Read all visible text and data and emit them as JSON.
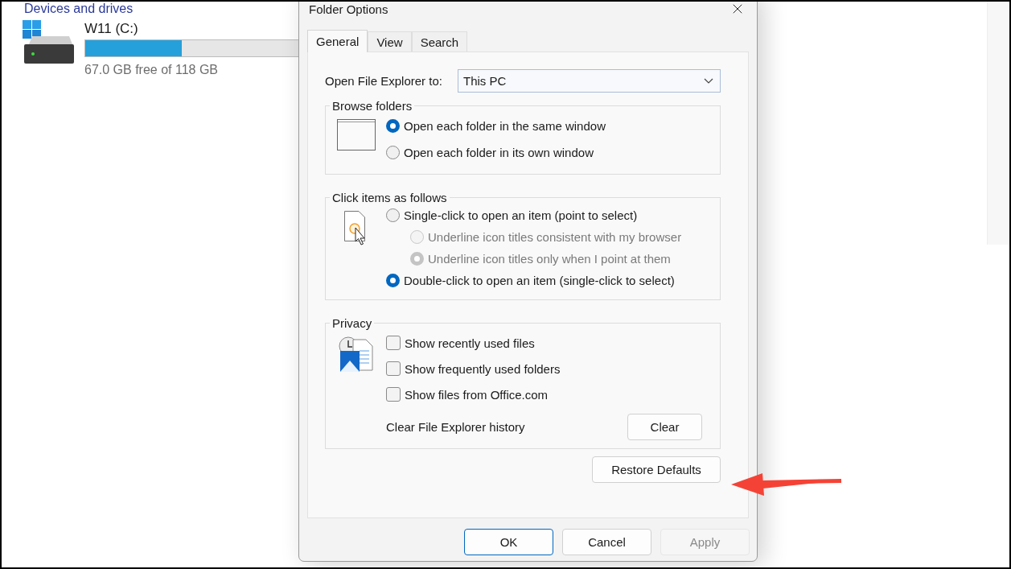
{
  "explorer": {
    "section_title": "Devices and drives",
    "drive": {
      "name": "W11 (C:)",
      "level": 0.43,
      "free": "67.0 GB free of 118 GB"
    }
  },
  "dialog": {
    "title": "Folder Options",
    "tabs": [
      {
        "label": "General",
        "selected": true
      },
      {
        "label": "View",
        "selected": false
      },
      {
        "label": "Search",
        "selected": false
      }
    ],
    "open_to": {
      "label": "Open File Explorer to:",
      "value": "This PC"
    },
    "groups": [
      {
        "title": "Browse folders",
        "options": [
          {
            "kind": "radio",
            "label": "Open each folder in the same window",
            "selected": true,
            "disabled": false
          },
          {
            "kind": "radio",
            "label": "Open each folder in its own window",
            "selected": false,
            "disabled": false
          }
        ]
      },
      {
        "title": "Click items as follows",
        "options": [
          {
            "kind": "radio",
            "label": "Single-click to open an item (point to select)",
            "selected": false,
            "disabled": false,
            "children": [
              {
                "kind": "radio",
                "label": "Underline icon titles consistent with my browser",
                "selected": false,
                "disabled": true
              },
              {
                "kind": "radio",
                "label": "Underline icon titles only when I point at them",
                "selected": true,
                "disabled": true
              }
            ]
          },
          {
            "kind": "radio",
            "label": "Double-click to open an item (single-click to select)",
            "selected": true,
            "disabled": false
          }
        ]
      },
      {
        "title": "Privacy",
        "options": [
          {
            "kind": "checkbox",
            "label": "Show recently used files",
            "checked": false
          },
          {
            "kind": "checkbox",
            "label": "Show frequently used folders",
            "checked": false
          },
          {
            "kind": "checkbox",
            "label": "Show files from Office.com",
            "checked": false
          },
          {
            "kind": "action",
            "label": "Clear File Explorer history",
            "button": "Clear"
          }
        ]
      }
    ],
    "restore_button": "Restore Defaults",
    "buttons": [
      {
        "label": "OK",
        "default": true,
        "disabled": false
      },
      {
        "label": "Cancel",
        "default": false,
        "disabled": false
      },
      {
        "label": "Apply",
        "default": false,
        "disabled": true
      }
    ]
  }
}
